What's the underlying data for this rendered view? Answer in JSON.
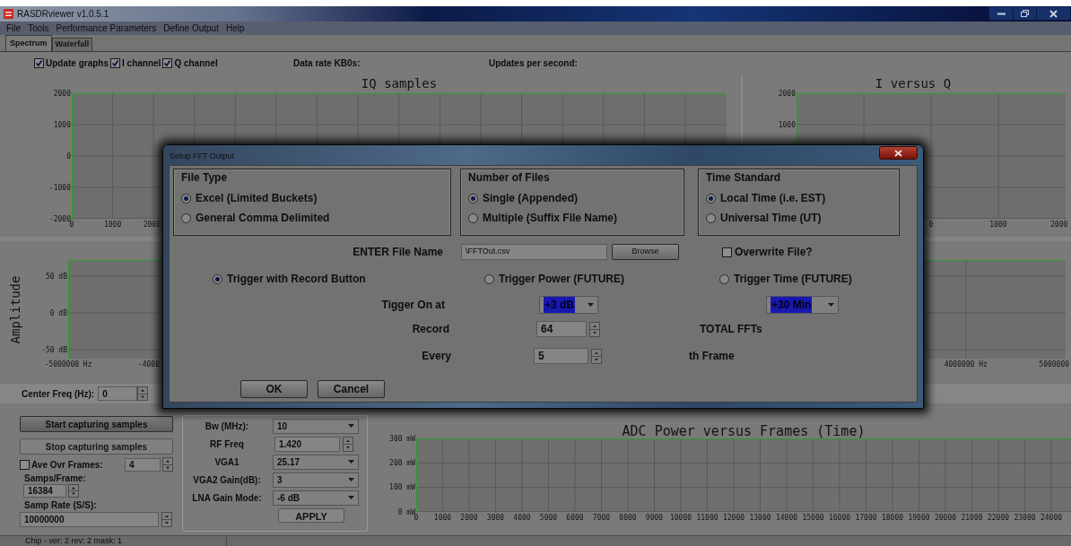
{
  "window": {
    "title": "RASDRviewer v1.0.5.1"
  },
  "menu": [
    "File",
    "Tools",
    "Performance Parameters",
    "Define Output",
    "Help"
  ],
  "tabs": [
    {
      "label": "Spectrum",
      "selected": true
    },
    {
      "label": "Waterfall",
      "selected": false
    }
  ],
  "options": [
    {
      "label": "Update graphs",
      "checked": true
    },
    {
      "label": "I channel",
      "checked": true
    },
    {
      "label": "Q channel",
      "checked": true
    }
  ],
  "readouts": [
    "Data rate KB0s:",
    "Updates per second:"
  ],
  "plots": [
    {
      "title": "IQ samples",
      "yticks": [
        "2000",
        "1000",
        "0",
        "-1000",
        "-2000"
      ],
      "xticks": [
        "0",
        "1000",
        "2000"
      ]
    },
    {
      "title": "I versus Q",
      "yticks": [
        "2000",
        "1000"
      ],
      "xticks": [
        "0",
        "1000",
        "2000"
      ]
    },
    {
      "ylabel": "Amplitude",
      "yticks": [
        "50 dB",
        "0 dB",
        "-50 dB"
      ],
      "xticks": [
        "-5000000 Hz",
        "-4000",
        "4000000 Hz",
        "5000000"
      ]
    },
    {
      "title": "ADC Power versus Frames (Time)",
      "yticks": [
        "300 mW",
        "200 mW",
        "100 mW",
        "0 mW"
      ],
      "xticks": [
        "0",
        "1000",
        "2000",
        "3000",
        "4000",
        "5000",
        "6000",
        "7000",
        "8000",
        "9000",
        "10000",
        "11000",
        "12000",
        "13000",
        "14000",
        "15000",
        "16000",
        "17000",
        "18000",
        "19000",
        "20000",
        "21000",
        "22000",
        "23000",
        "24000"
      ]
    }
  ],
  "center_freq": {
    "label": "Center Freq (Hz):",
    "value": "0"
  },
  "capture": {
    "buttons": [
      "Start capturing samples",
      "Stop capturing samples"
    ],
    "average": {
      "label": "Ave Ovr Frames:",
      "checked": false,
      "value": "4"
    },
    "samps_per_frame": {
      "label": "Samps/Frame:",
      "value": "16384"
    },
    "samp_rate": {
      "label": "Samp Rate (S/S):",
      "value": "10000000"
    }
  },
  "radio_settings": {
    "rows": [
      {
        "kind": "select",
        "label": "Bw (MHz):",
        "value": "10"
      },
      {
        "kind": "spin",
        "label": "RF Freq",
        "value": "1.420"
      },
      {
        "kind": "select",
        "label": "VGA1",
        "value": "25.17"
      },
      {
        "kind": "select",
        "label": "VGA2 Gain(dB):",
        "value": "3"
      },
      {
        "kind": "select",
        "label": "LNA Gain Mode:",
        "value": "-6 dB"
      }
    ],
    "apply": "APPLY"
  },
  "status_bar": "Chip - ver: 2 rev: 2 mask: 1",
  "dialog": {
    "title": "Setup FFT Output",
    "groups": [
      {
        "title": "File Type",
        "options": [
          {
            "label": "Excel (Limited Buckets)",
            "selected": true
          },
          {
            "label": "General Comma Delimited",
            "selected": false
          }
        ]
      },
      {
        "title": "Number of Files",
        "options": [
          {
            "label": "Single (Appended)",
            "selected": true
          },
          {
            "label": "Multiple (Suffix File Name)",
            "selected": false
          }
        ]
      },
      {
        "title": "Time Standard",
        "options": [
          {
            "label": "Local Time (i.e. EST)",
            "selected": true
          },
          {
            "label": "Universal Time (UT)",
            "selected": false
          }
        ]
      }
    ],
    "file_name": {
      "label": "ENTER File Name",
      "value": "\\FFTOut.csv",
      "browse": "Browse"
    },
    "overwrite": {
      "label": "Overwrite File?",
      "checked": false
    },
    "triggers": [
      {
        "label": "Trigger with Record Button",
        "selected": true
      },
      {
        "label": "Trigger Power (FUTURE)",
        "selected": false
      },
      {
        "label": "Trigger Time (FUTURE)",
        "selected": false
      }
    ],
    "trigger_on": {
      "label": "Tigger On at",
      "power": "+3 dB",
      "time": "+30 Min"
    },
    "record": {
      "label": "Record",
      "value": "64",
      "suffix": "TOTAL FFTs"
    },
    "every": {
      "label": "Every",
      "value": "5",
      "suffix": "th Frame"
    },
    "buttons": [
      "OK",
      "Cancel"
    ]
  }
}
